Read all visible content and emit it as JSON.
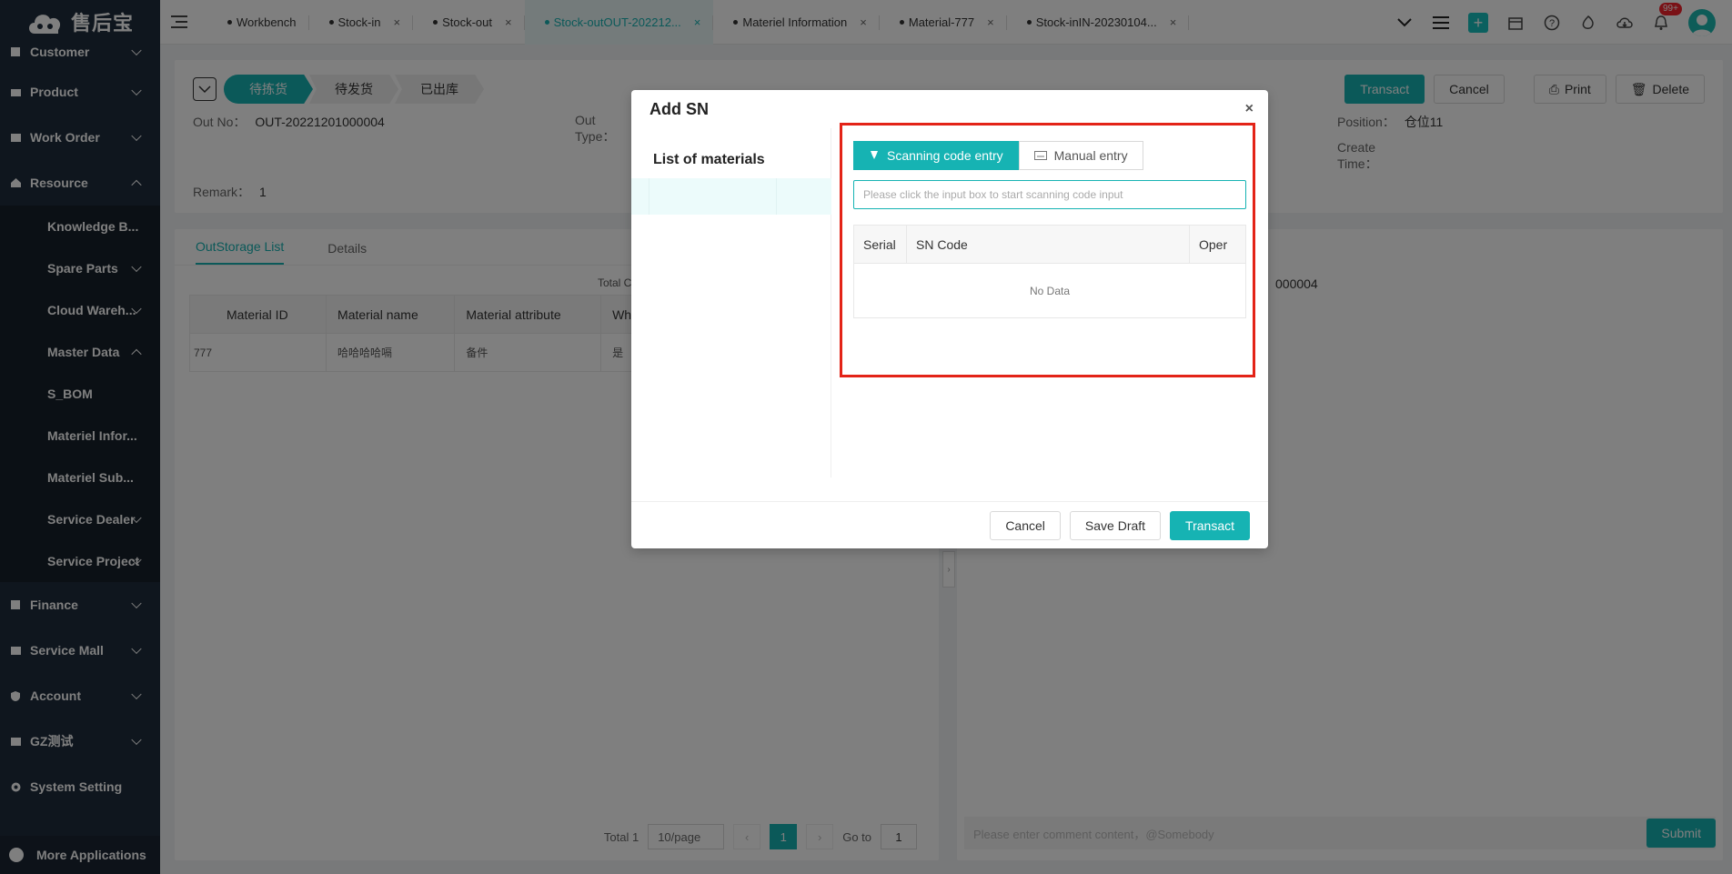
{
  "app": {
    "logo_text": "售后宝"
  },
  "sidebar": {
    "items": [
      {
        "label": "Customer"
      },
      {
        "label": "Product"
      },
      {
        "label": "Work Order"
      },
      {
        "label": "Resource"
      }
    ],
    "resource_children": [
      {
        "label": "Knowledge B..."
      },
      {
        "label": "Spare Parts"
      },
      {
        "label": "Cloud Wareh..."
      },
      {
        "label": "Master Data"
      }
    ],
    "master_data_children": [
      {
        "label": "S_BOM"
      },
      {
        "label": "Materiel Infor..."
      },
      {
        "label": "Materiel Sub..."
      }
    ],
    "service_children": [
      {
        "label": "Service Dealer"
      },
      {
        "label": "Service Project"
      }
    ],
    "bottom_items": [
      {
        "label": "Finance"
      },
      {
        "label": "Service Mall"
      },
      {
        "label": "Account"
      },
      {
        "label": "GZ测试"
      },
      {
        "label": "System Setting"
      }
    ],
    "more_apps": "More Applications"
  },
  "tabs": [
    {
      "label": "Workbench",
      "closable": false
    },
    {
      "label": "Stock-in",
      "closable": true
    },
    {
      "label": "Stock-out",
      "closable": true
    },
    {
      "label": "Stock-outOUT-202212...",
      "closable": true,
      "active": true
    },
    {
      "label": "Materiel Information",
      "closable": true
    },
    {
      "label": "Material-777",
      "closable": true
    },
    {
      "label": "Stock-inIN-20230104...",
      "closable": true
    }
  ],
  "topbar": {
    "notification_badge": "99+"
  },
  "order": {
    "steps": [
      "待拣货",
      "待发货",
      "已出库"
    ],
    "out_no_label": "Out No：",
    "out_no": "OUT-20221201000004",
    "out_type_label": "Out Type：",
    "position_label": "Position：",
    "position": "仓位11",
    "create_time_label": "Create Time：",
    "remark_label": "Remark：",
    "remark": "1",
    "transact": "Transact",
    "cancel": "Cancel",
    "print": "Print",
    "delete": "Delete"
  },
  "list": {
    "tabs": [
      "OutStorage List",
      "Details"
    ],
    "total_label": "Total C",
    "code_tail": "000004",
    "columns": [
      "Material ID",
      "Material name",
      "Material attribute",
      "Whe"
    ],
    "rows": [
      {
        "id": "777",
        "name": "哈哈哈哈嗝",
        "attr": "备件",
        "whe": "是"
      }
    ],
    "pager": {
      "total": "Total 1",
      "page_size": "10/page",
      "current": "1",
      "goto_label": "Go to",
      "goto_value": "1"
    }
  },
  "comment": {
    "placeholder": "Please enter comment content，@Somebody",
    "submit": "Submit"
  },
  "modal": {
    "title": "Add SN",
    "close": "×",
    "materials_title": "List of materials",
    "entry_tabs": [
      "Scanning code entry",
      "Manual entry"
    ],
    "scan_placeholder": "Please click the input box to start scanning code input",
    "columns": [
      "Serial",
      "SN Code",
      "Oper"
    ],
    "empty": "No Data",
    "cancel": "Cancel",
    "save_draft": "Save Draft",
    "transact": "Transact"
  },
  "colors": {
    "accent": "#16b3b3",
    "sidebar_bg": "#1f2d3d",
    "highlight": "#e32317"
  }
}
